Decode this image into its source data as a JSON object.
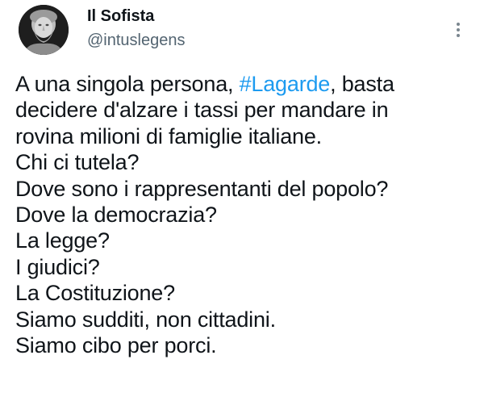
{
  "author": {
    "name": "Il Sofista",
    "handle": "@intuslegens",
    "avatar_icon": "bust-portrait-avatar"
  },
  "menu": {
    "icon": "more-vertical-icon"
  },
  "tweet": {
    "line1_before": "A una singola persona, ",
    "line1_hashtag": "#Lagarde",
    "line1_after": ", basta",
    "lines": [
      "decidere d'alzare i tassi per mandare in",
      "rovina milioni di famiglie italiane.",
      "Chi ci tutela?",
      "Dove sono i rappresentanti del popolo?",
      "Dove la democrazia?",
      "La legge?",
      "I giudici?",
      "La Costituzione?",
      "Siamo sudditi, non cittadini.",
      "Siamo cibo per porci."
    ]
  },
  "colors": {
    "text": "#0f1419",
    "secondary": "#536471",
    "hashtag": "#1d9bf0"
  }
}
